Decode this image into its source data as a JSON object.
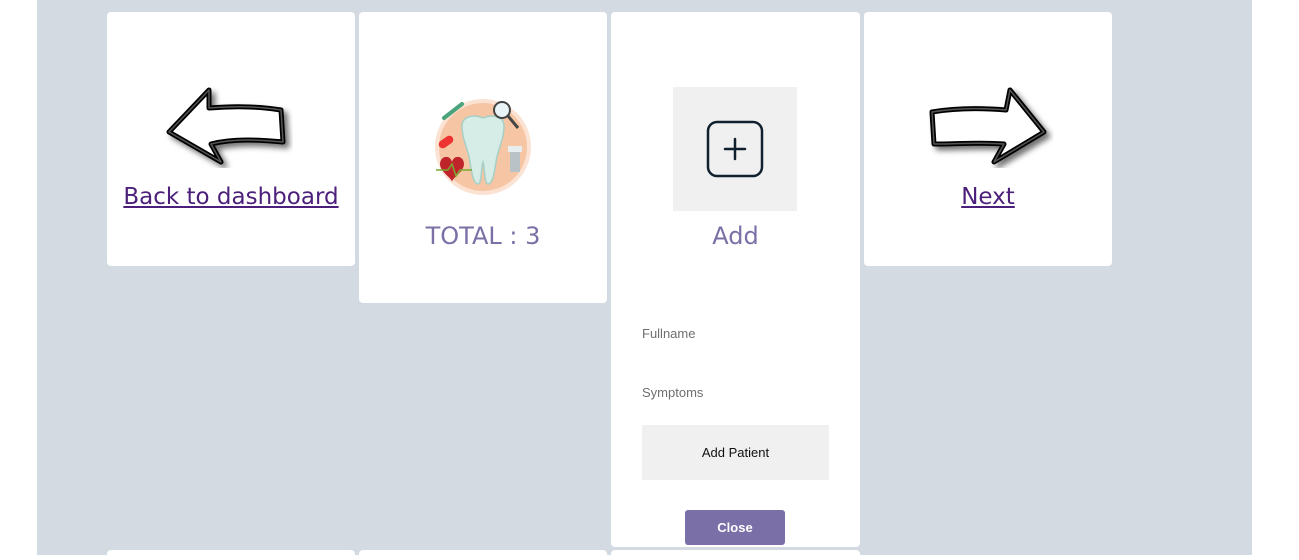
{
  "cards": {
    "back": {
      "link_label": "Back to dashboard",
      "icon": "left-arrow-icon"
    },
    "total": {
      "caption": "TOTAL : 3",
      "icon": "dental-tooth-icon"
    },
    "add": {
      "caption": "Add",
      "icon": "plus-square-icon",
      "form": {
        "fullname_label": "Fullname",
        "symptoms_label": "Symptoms",
        "add_patient_label": "Add Patient",
        "close_label": "Close"
      }
    },
    "next": {
      "link_label": "Next",
      "icon": "right-arrow-icon"
    }
  },
  "colors": {
    "page_background": "#d3dae2",
    "card_background": "#ffffff",
    "link": "#4b1f7a",
    "caption": "#7b6fa6",
    "close_button": "#7a6fa6",
    "add_tile": "#f0f0f0"
  }
}
